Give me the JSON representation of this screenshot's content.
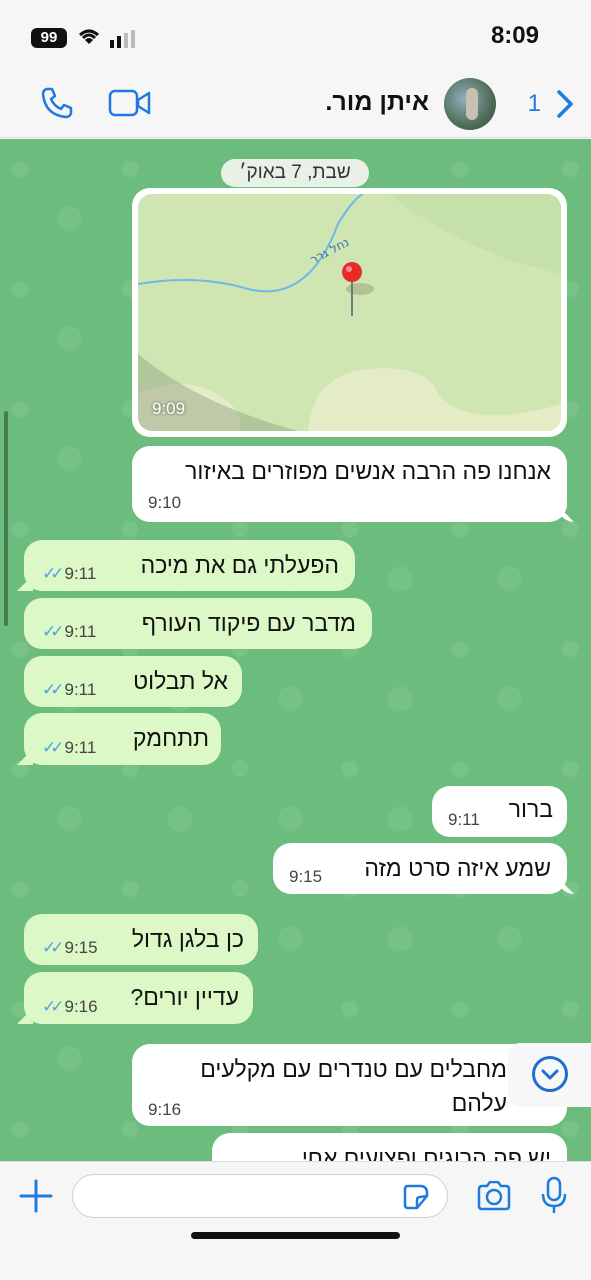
{
  "status_bar": {
    "battery": "99",
    "time": "8:09"
  },
  "header": {
    "contact_name": "איתן מור.",
    "unread_count": "1",
    "icons": [
      "phone-icon",
      "video-icon",
      "back-chevron-icon"
    ]
  },
  "chat": {
    "date_separator": "שבת, 7 באוק׳",
    "location_message": {
      "map_label": "נחל גרר",
      "time": "9:09"
    },
    "messages": [
      {
        "text": "אנחנו פה הרבה אנשים מפוזרים באיזור",
        "time": "9:10",
        "direction": "incoming"
      },
      {
        "text": "הפעלתי גם את מיכה",
        "time": "9:11",
        "direction": "outgoing"
      },
      {
        "text": "מדבר עם פיקוד העורף",
        "time": "9:11",
        "direction": "outgoing"
      },
      {
        "text": "אל תבלוט",
        "time": "9:11",
        "direction": "outgoing"
      },
      {
        "text": "תתחמק",
        "time": "9:11",
        "direction": "outgoing"
      },
      {
        "text": "ברור",
        "time": "9:11",
        "direction": "incoming"
      },
      {
        "text": "שמע איזה סרט מזה",
        "time": "9:15",
        "direction": "incoming"
      },
      {
        "text": "כן בלגן גדול",
        "time": "9:15",
        "direction": "outgoing"
      },
      {
        "text": "עדיין יורים?",
        "time": "9:16",
        "direction": "outgoing"
      },
      {
        "text_line1": "מחבלים עם טנדרים עם מקלעים",
        "text_line2": "עלהם",
        "time": "9:16",
        "direction": "incoming"
      },
      {
        "text": "יש פה הרוגים ופצועים אחי",
        "direction": "incoming"
      }
    ]
  },
  "colors": {
    "chat_bg": "#6cbc7d",
    "incoming": "#ffffff",
    "outgoing": "#dcf8c6",
    "accent": "#1f7ae0",
    "read_ticks": "#4fa3e0"
  }
}
